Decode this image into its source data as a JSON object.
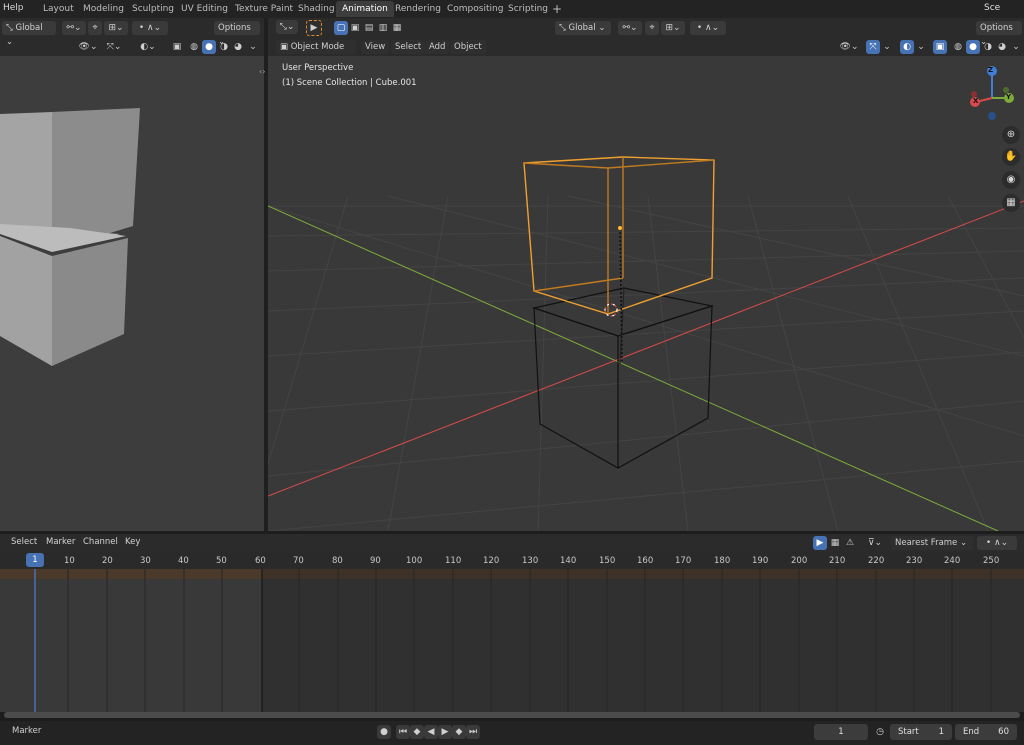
{
  "topbar": {
    "help": "Help",
    "tabs": [
      "Layout",
      "Modeling",
      "Sculpting",
      "UV Editing",
      "Texture Paint",
      "Shading",
      "Animation",
      "Rendering",
      "Compositing",
      "Scripting"
    ],
    "active_tab": "Animation",
    "plus": "+",
    "scene": "Sce"
  },
  "left_header": {
    "orientation": "Global",
    "options": "Options"
  },
  "main_header": {
    "orientation": "Global",
    "options": "Options",
    "mode": "Object Mode",
    "menus": [
      "View",
      "Select",
      "Add",
      "Object"
    ]
  },
  "viewport": {
    "perspective": "User Perspective",
    "collection": "(1) Scene Collection | Cube.001",
    "gizmo": {
      "z": "Z",
      "y": "Y",
      "x": "X"
    }
  },
  "timeline": {
    "menus": [
      "Select",
      "Marker",
      "Channel",
      "Key"
    ],
    "snap": "Nearest Frame",
    "current_frame": "1",
    "ticks": [
      "10",
      "20",
      "30",
      "40",
      "50",
      "60",
      "70",
      "80",
      "90",
      "100",
      "110",
      "120",
      "130",
      "140",
      "150",
      "160",
      "170",
      "180",
      "190",
      "200",
      "210",
      "220",
      "230",
      "240",
      "250"
    ],
    "bottom_left": "Marker",
    "frame_field": "1",
    "start_label": "Start",
    "start_value": "1",
    "end_label": "End",
    "end_value": "60"
  },
  "colors": {
    "selected_outline": "#f0a030",
    "x_axis": "#d84a4a",
    "y_axis": "#7dac3a",
    "z_axis": "#3f7fd8",
    "active_blue": "#4772b3"
  }
}
